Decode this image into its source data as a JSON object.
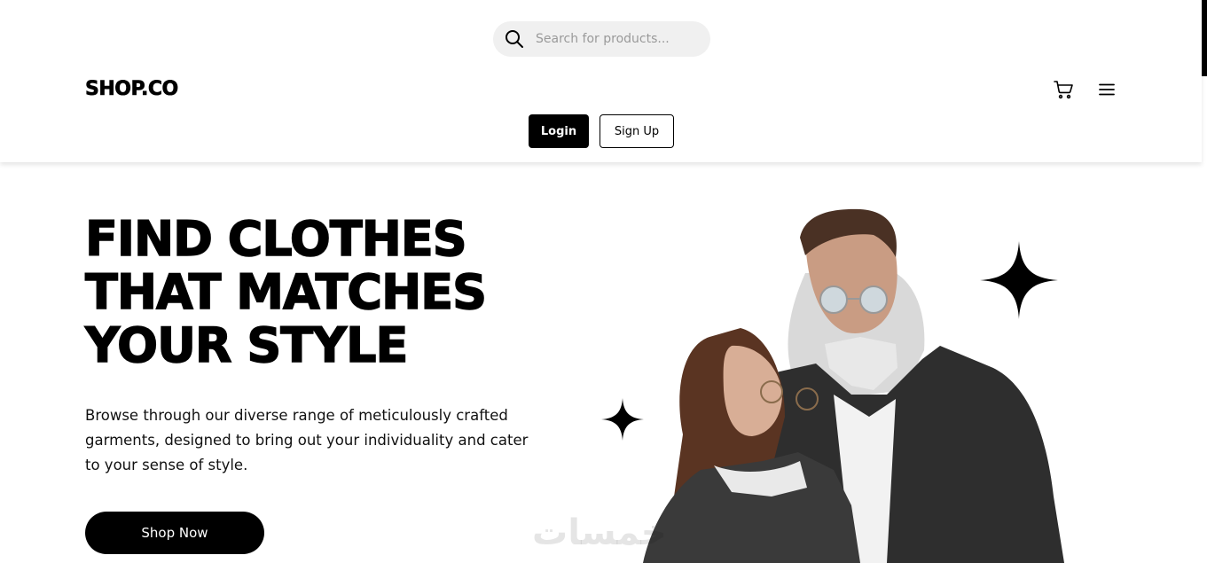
{
  "search": {
    "placeholder": "Search for products..."
  },
  "header": {
    "logo": "SHOP.CO",
    "login_label": "Login",
    "signup_label": "Sign Up",
    "icons": [
      "search-icon",
      "cart-icon",
      "menu-icon"
    ]
  },
  "hero": {
    "title_lines": [
      "FIND CLOTHES",
      "THAT MATCHES",
      "YOUR STYLE"
    ],
    "description": "Browse through our diverse range of meticulously crafted garments, designed to bring out your individuality and cater to your sense of style.",
    "cta_label": "Shop Now",
    "image_alt": "couple-in-denim-jackets-photo",
    "decorations": [
      "sparkle-star-large",
      "sparkle-star-small"
    ]
  },
  "watermark": "خمسات",
  "colors": {
    "primary": "#000000",
    "background": "#ffffff",
    "search_bg": "#f0f0f0"
  }
}
